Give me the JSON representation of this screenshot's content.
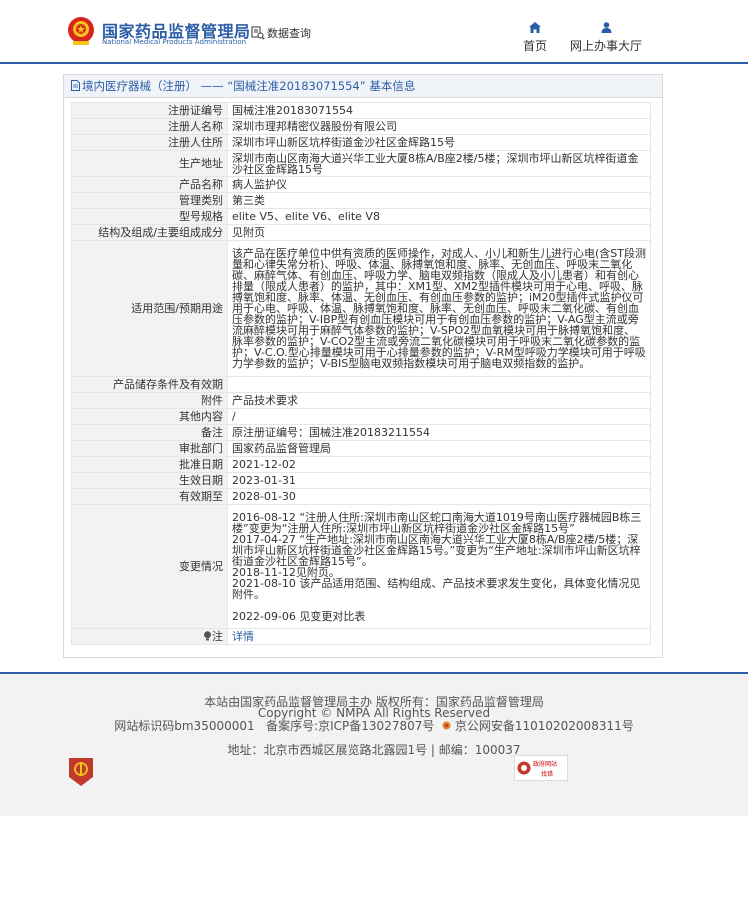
{
  "header": {
    "logo_cn": "国家药品监督管理局",
    "logo_en": "National Medical Products Administration",
    "data_query": "数据查询",
    "nav": [
      {
        "label": "首页",
        "icon": "home-icon"
      },
      {
        "label": "网上办事大厅",
        "icon": "user-icon"
      }
    ]
  },
  "panel": {
    "title": "境内医疗器械（注册） —— “国械注准20183071554” 基本信息"
  },
  "rows": [
    {
      "key": "注册证编号",
      "value": "国械注准20183071554"
    },
    {
      "key": "注册人名称",
      "value": "深圳市理邦精密仪器股份有限公司"
    },
    {
      "key": "注册人住所",
      "value": "深圳市坪山新区坑梓街道金沙社区金辉路15号"
    },
    {
      "key": "生产地址",
      "value": "深圳市南山区南海大道兴华工业大厦8栋A/B座2楼/5楼；深圳市坪山新区坑梓街道金沙社区金辉路15号"
    },
    {
      "key": "产品名称",
      "value": "病人监护仪"
    },
    {
      "key": "管理类别",
      "value": "第三类"
    },
    {
      "key": "型号规格",
      "value": "elite V5、elite V6、elite V8"
    },
    {
      "key": "结构及组成/主要组成成分",
      "value": "见附页"
    },
    {
      "key": "适用范围/预期用途",
      "value": "该产品在医疗单位中供有资质的医师操作，对成人、小儿和新生儿进行心电(含ST段测量和心律失常分析)、呼吸、体温、脉搏氧饱和度、脉率、无创血压、呼吸末二氧化碳、麻醉气体、有创血压、呼吸力学、脑电双频指数（限成人及小儿患者）和有创心排量（限成人患者）的监护，其中：XM1型、XM2型插件模块可用于心电、呼吸、脉搏氧饱和度、脉率、体温、无创血压、有创血压参数的监护；iM20型插件式监护仪可用于心电、呼吸、体温、脉搏氧饱和度、脉率、无创血压、呼吸末二氧化碳、有创血压参数的监护；V-IBP型有创血压模块可用于有创血压参数的监护；V-AG型主流或旁流麻醉模块可用于麻醉气体参数的监护；V-SPO2型血氧模块可用于脉搏氧饱和度、脉率参数的监护；V-CO2型主流或旁流二氧化碳模块可用于呼吸末二氧化碳参数的监护；V-C.O.型心排量模块可用于心排量参数的监护；V-RM型呼吸力学模块可用于呼吸力学参数的监护；V-BIS型脑电双频指数模块可用于脑电双频指数的监护。"
    },
    {
      "key": "产品储存条件及有效期",
      "value": ""
    },
    {
      "key": "附件",
      "value": "产品技术要求"
    },
    {
      "key": "其他内容",
      "value": "/"
    },
    {
      "key": "备注",
      "value": "原注册证编号：国械注准20183211554"
    },
    {
      "key": "审批部门",
      "value": "国家药品监督管理局"
    },
    {
      "key": "批准日期",
      "value": "2021-12-02"
    },
    {
      "key": "生效日期",
      "value": "2023-01-31"
    },
    {
      "key": "有效期至",
      "value": "2028-01-30"
    }
  ],
  "change": {
    "key": "变更情况",
    "entries": [
      "2016-08-12 “注册人住所:深圳市南山区蛇口南海大道1019号南山医疗器械园B栋三楼”变更为“注册人住所:深圳市坪山新区坑梓街道金沙社区金辉路15号”",
      "2017-04-27 “生产地址:深圳市南山区南海大道兴华工业大厦8栋A/B座2楼/5楼；深圳市坪山新区坑梓街道金沙社区金辉路15号。”变更为“生产地址:深圳市坪山新区坑梓街道金沙社区金辉路15号”。",
      "2018-11-12见附页。",
      "2021-08-10 该产品适用范围、结构组成、产品技术要求发生变化，具体变化情况见附件。",
      "2022-09-06 见变更对比表"
    ]
  },
  "note": {
    "key": "注",
    "link": "详情"
  },
  "footer": {
    "line1": "本站由国家药品监督管理局主办 版权所有：国家药品监督管理局",
    "line2": "Copyright © NMPA All Rights Reserved",
    "line3a": "网站标识码bm35000001",
    "line3b": "备案序号:京ICP备13027807号",
    "line3c": "京公网安备11010202008311号",
    "line4": "地址：北京市西城区展览路北露园1号 | 邮编：100037",
    "badge_top": "政府网站",
    "badge_bottom": "找错"
  }
}
